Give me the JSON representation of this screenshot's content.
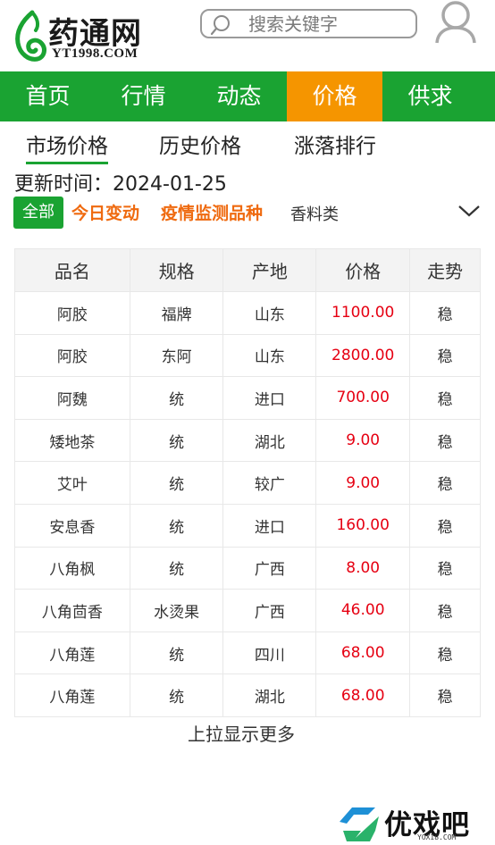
{
  "header": {
    "logo_text": "药通网",
    "logo_domain": "YT1998.COM",
    "search_placeholder": "搜索关键字"
  },
  "nav": [
    {
      "label": "首页",
      "active": false
    },
    {
      "label": "行情",
      "active": false
    },
    {
      "label": "动态",
      "active": false
    },
    {
      "label": "价格",
      "active": true
    },
    {
      "label": "供求",
      "active": false
    }
  ],
  "subtabs": [
    {
      "label": "市场价格",
      "active": true
    },
    {
      "label": "历史价格",
      "active": false
    },
    {
      "label": "涨落排行",
      "active": false
    }
  ],
  "update": {
    "label": "更新时间：",
    "date": "2024-01-25"
  },
  "filters": {
    "all": "全部",
    "today": "今日变动",
    "epidemic": "疫情监测品种",
    "spice": "香料类"
  },
  "table": {
    "headers": [
      "品名",
      "规格",
      "产地",
      "价格",
      "走势"
    ],
    "rows": [
      [
        "阿胶",
        "福牌",
        "山东",
        "1100.00",
        "稳"
      ],
      [
        "阿胶",
        "东阿",
        "山东",
        "2800.00",
        "稳"
      ],
      [
        "阿魏",
        "统",
        "进口",
        "700.00",
        "稳"
      ],
      [
        "矮地茶",
        "统",
        "湖北",
        "9.00",
        "稳"
      ],
      [
        "艾叶",
        "统",
        "较广",
        "9.00",
        "稳"
      ],
      [
        "安息香",
        "统",
        "进口",
        "160.00",
        "稳"
      ],
      [
        "八角枫",
        "统",
        "广西",
        "8.00",
        "稳"
      ],
      [
        "八角茴香",
        "水烫果",
        "广西",
        "46.00",
        "稳"
      ],
      [
        "八角莲",
        "统",
        "四川",
        "68.00",
        "稳"
      ],
      [
        "八角莲",
        "统",
        "湖北",
        "68.00",
        "稳"
      ]
    ]
  },
  "more_label": "上拉显示更多",
  "watermark": {
    "text": "优戏吧",
    "sub": "YOXI8.COM"
  },
  "colors": {
    "green": "#1aa332",
    "orange": "#f59500",
    "price_red": "#e60012",
    "filter_orange": "#ef6a0f"
  }
}
